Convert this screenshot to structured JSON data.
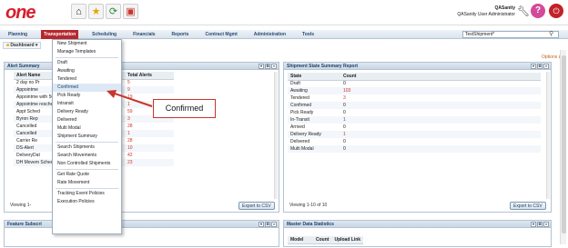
{
  "app": {
    "logo_text": "one"
  },
  "user": {
    "name": "QASanity",
    "role": "QASanity User Administrator"
  },
  "icons": {
    "home": "home-icon",
    "star": "star-icon",
    "refresh": "refresh-icon",
    "screen": "screen-icon",
    "wrench": "wrench-icon",
    "help": "help-icon",
    "power": "power-icon",
    "search": "search-icon"
  },
  "nav": {
    "items": [
      "Planning",
      "Transportation",
      "Scheduling",
      "Financials",
      "Reports",
      "Contract Mgmt",
      "Administration",
      "Tools"
    ],
    "active": "Transportation"
  },
  "search": {
    "value": "TestShipment*"
  },
  "dashboard": {
    "tab_label": "Dashboard",
    "options_label": "Options"
  },
  "menu": {
    "items": [
      {
        "label": "New Shipment"
      },
      {
        "label": "Manage Templates"
      },
      {
        "sep": true
      },
      {
        "label": "Draft"
      },
      {
        "label": "Awaiting"
      },
      {
        "label": "Tendered"
      },
      {
        "label": "Confirmed",
        "selected": true
      },
      {
        "label": "Pick Ready"
      },
      {
        "label": "Intransit"
      },
      {
        "label": "Delivery Ready"
      },
      {
        "label": "Delivered"
      },
      {
        "label": "Multi Modal"
      },
      {
        "label": "Shipment Summary"
      },
      {
        "sep": true
      },
      {
        "label": "Search Shipments"
      },
      {
        "label": "Search Movements"
      },
      {
        "label": "Non Controlled Shipments"
      },
      {
        "sep": true
      },
      {
        "label": "Get Rate Quote"
      },
      {
        "label": "Rate Movement"
      },
      {
        "sep": true
      },
      {
        "label": "Tracking Event Policies"
      },
      {
        "label": "Execution Policies"
      }
    ]
  },
  "callout": {
    "text": "Confirmed"
  },
  "alert_panel": {
    "title": "Alert Summary",
    "columns": [
      "Alert Name",
      "Total Alerts"
    ],
    "rows": [
      {
        "name": "2 day no Pr",
        "total": "5"
      },
      {
        "name": "Appointme",
        "total": "9"
      },
      {
        "name": "Appointme with 56 thr",
        "total": "19"
      },
      {
        "name": "Appointme rescheduled threshold",
        "total": "1"
      },
      {
        "name": "Appt Sched",
        "total": "59"
      },
      {
        "name": "Byron Rep",
        "total": "3"
      },
      {
        "name": "Cancelled",
        "total": "28"
      },
      {
        "name": "Cancelled",
        "total": "1"
      },
      {
        "name": "Carrier Re",
        "total": "28"
      },
      {
        "name": "DS-Alert",
        "total": "10"
      },
      {
        "name": "DeliveryDat",
        "total": "42"
      },
      {
        "name": "DH Movem Scheduled Deliver",
        "total": "23"
      }
    ],
    "viewing": "Viewing 1-",
    "export_label": "Export to CSV"
  },
  "status_panel": {
    "title": "Shipment State Summary Report",
    "columns": [
      "State",
      "Count"
    ],
    "rows": [
      {
        "state": "Draft",
        "count": "0",
        "color": "plain"
      },
      {
        "state": "Awaiting",
        "count": "103",
        "color": "red"
      },
      {
        "state": "Tendered",
        "count": "3",
        "color": "red"
      },
      {
        "state": "Confirmed",
        "count": "0",
        "color": "plain"
      },
      {
        "state": "Pick Ready",
        "count": "0",
        "color": "plain"
      },
      {
        "state": "In-Transit",
        "count": "1",
        "color": "blue"
      },
      {
        "state": "Arrived",
        "count": "0",
        "color": "plain"
      },
      {
        "state": "Delivery Ready",
        "count": "1",
        "color": "red"
      },
      {
        "state": "Delivered",
        "count": "0",
        "color": "plain"
      },
      {
        "state": "Multi Modal",
        "count": "0",
        "color": "plain"
      }
    ],
    "viewing": "Viewing 1-10 of 10",
    "export_label": "Export to CSV"
  },
  "feature_panel": {
    "title": "Feature Subscri"
  },
  "master_panel": {
    "title": "Master Data Statistics",
    "columns": [
      "Model",
      "Count",
      "Upload Link"
    ]
  },
  "colors": {
    "accent": "#b7282e",
    "logo": "#d81e2c",
    "panel_header": "#1d3f66",
    "red_value": "#c8352d",
    "blue_value": "#2e5fa5"
  }
}
